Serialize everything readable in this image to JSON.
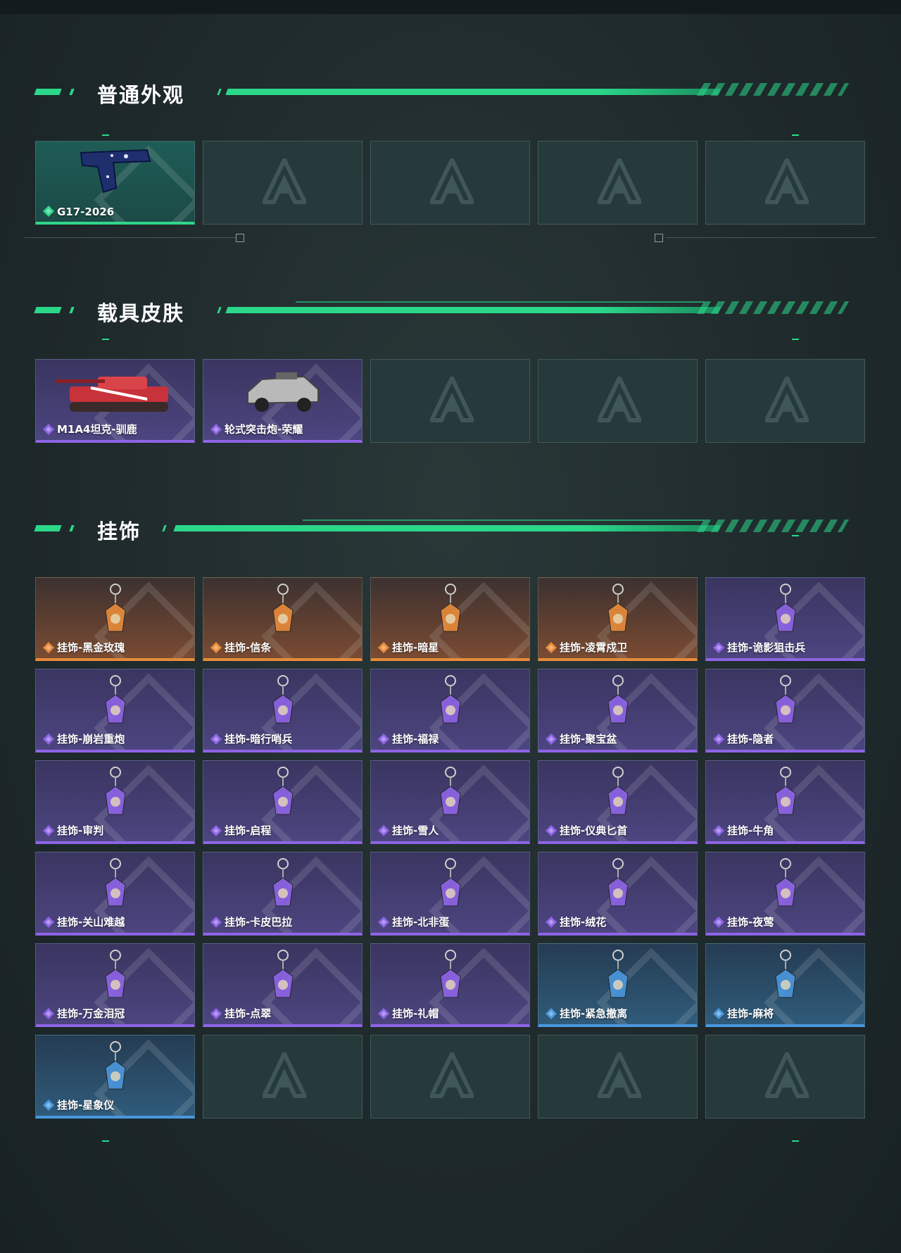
{
  "sections": [
    {
      "title": "普通外观",
      "items": [
        {
          "label": "G17-2026",
          "rarity": "green",
          "icon": "pistol-icon"
        },
        {
          "label": "",
          "rarity": "empty"
        },
        {
          "label": "",
          "rarity": "empty"
        },
        {
          "label": "",
          "rarity": "empty"
        },
        {
          "label": "",
          "rarity": "empty"
        }
      ]
    },
    {
      "title": "载具皮肤",
      "items": [
        {
          "label": "M1A4坦克-驯鹿",
          "rarity": "purple",
          "icon": "tank-icon"
        },
        {
          "label": "轮式突击炮-荣耀",
          "rarity": "purple",
          "icon": "armored-car-icon"
        },
        {
          "label": "",
          "rarity": "empty"
        },
        {
          "label": "",
          "rarity": "empty"
        },
        {
          "label": "",
          "rarity": "empty"
        }
      ]
    },
    {
      "title": "挂饰",
      "items": [
        {
          "label": "挂饰-黑金玫瑰",
          "rarity": "orange",
          "icon": "charm-icon"
        },
        {
          "label": "挂饰-信条",
          "rarity": "orange",
          "icon": "charm-icon"
        },
        {
          "label": "挂饰-暗星",
          "rarity": "orange",
          "icon": "charm-icon"
        },
        {
          "label": "挂饰-凌霄戍卫",
          "rarity": "orange",
          "icon": "charm-icon"
        },
        {
          "label": "挂饰-诡影狙击兵",
          "rarity": "purple",
          "icon": "charm-icon"
        },
        {
          "label": "挂饰-崩岩重炮",
          "rarity": "purple",
          "icon": "charm-icon"
        },
        {
          "label": "挂饰-暗行哨兵",
          "rarity": "purple",
          "icon": "charm-icon"
        },
        {
          "label": "挂饰-福禄",
          "rarity": "purple",
          "icon": "charm-icon"
        },
        {
          "label": "挂饰-聚宝盆",
          "rarity": "purple",
          "icon": "charm-icon"
        },
        {
          "label": "挂饰-隐者",
          "rarity": "purple",
          "icon": "charm-icon"
        },
        {
          "label": "挂饰-审判",
          "rarity": "purple",
          "icon": "charm-icon"
        },
        {
          "label": "挂饰-启程",
          "rarity": "purple",
          "icon": "charm-icon"
        },
        {
          "label": "挂饰-雪人",
          "rarity": "purple",
          "icon": "charm-icon"
        },
        {
          "label": "挂饰-仪典匕首",
          "rarity": "purple",
          "icon": "charm-icon"
        },
        {
          "label": "挂饰-牛角",
          "rarity": "purple",
          "icon": "charm-icon"
        },
        {
          "label": "挂饰-关山难越",
          "rarity": "purple",
          "icon": "charm-icon"
        },
        {
          "label": "挂饰-卡皮巴拉",
          "rarity": "purple",
          "icon": "charm-icon"
        },
        {
          "label": "挂饰-北非蛋",
          "rarity": "purple",
          "icon": "charm-icon"
        },
        {
          "label": "挂饰-绒花",
          "rarity": "purple",
          "icon": "charm-icon"
        },
        {
          "label": "挂饰-夜莺",
          "rarity": "purple",
          "icon": "charm-icon"
        },
        {
          "label": "挂饰-万金泪冠",
          "rarity": "purple",
          "icon": "charm-icon"
        },
        {
          "label": "挂饰-点翠",
          "rarity": "purple",
          "icon": "charm-icon"
        },
        {
          "label": "挂饰-礼帽",
          "rarity": "purple",
          "icon": "charm-icon"
        },
        {
          "label": "挂饰-紧急撤离",
          "rarity": "blue",
          "icon": "charm-icon"
        },
        {
          "label": "挂饰-麻将",
          "rarity": "blue",
          "icon": "charm-icon"
        },
        {
          "label": "挂饰-星象仪",
          "rarity": "blue",
          "icon": "charm-icon"
        },
        {
          "label": "",
          "rarity": "empty"
        },
        {
          "label": "",
          "rarity": "empty"
        },
        {
          "label": "",
          "rarity": "empty"
        },
        {
          "label": "",
          "rarity": "empty"
        }
      ]
    }
  ],
  "colors": {
    "accent": "#2bd88a",
    "green": "#31d58b",
    "purple": "#8e64e6",
    "orange": "#e88b3a",
    "blue": "#4a97de"
  }
}
